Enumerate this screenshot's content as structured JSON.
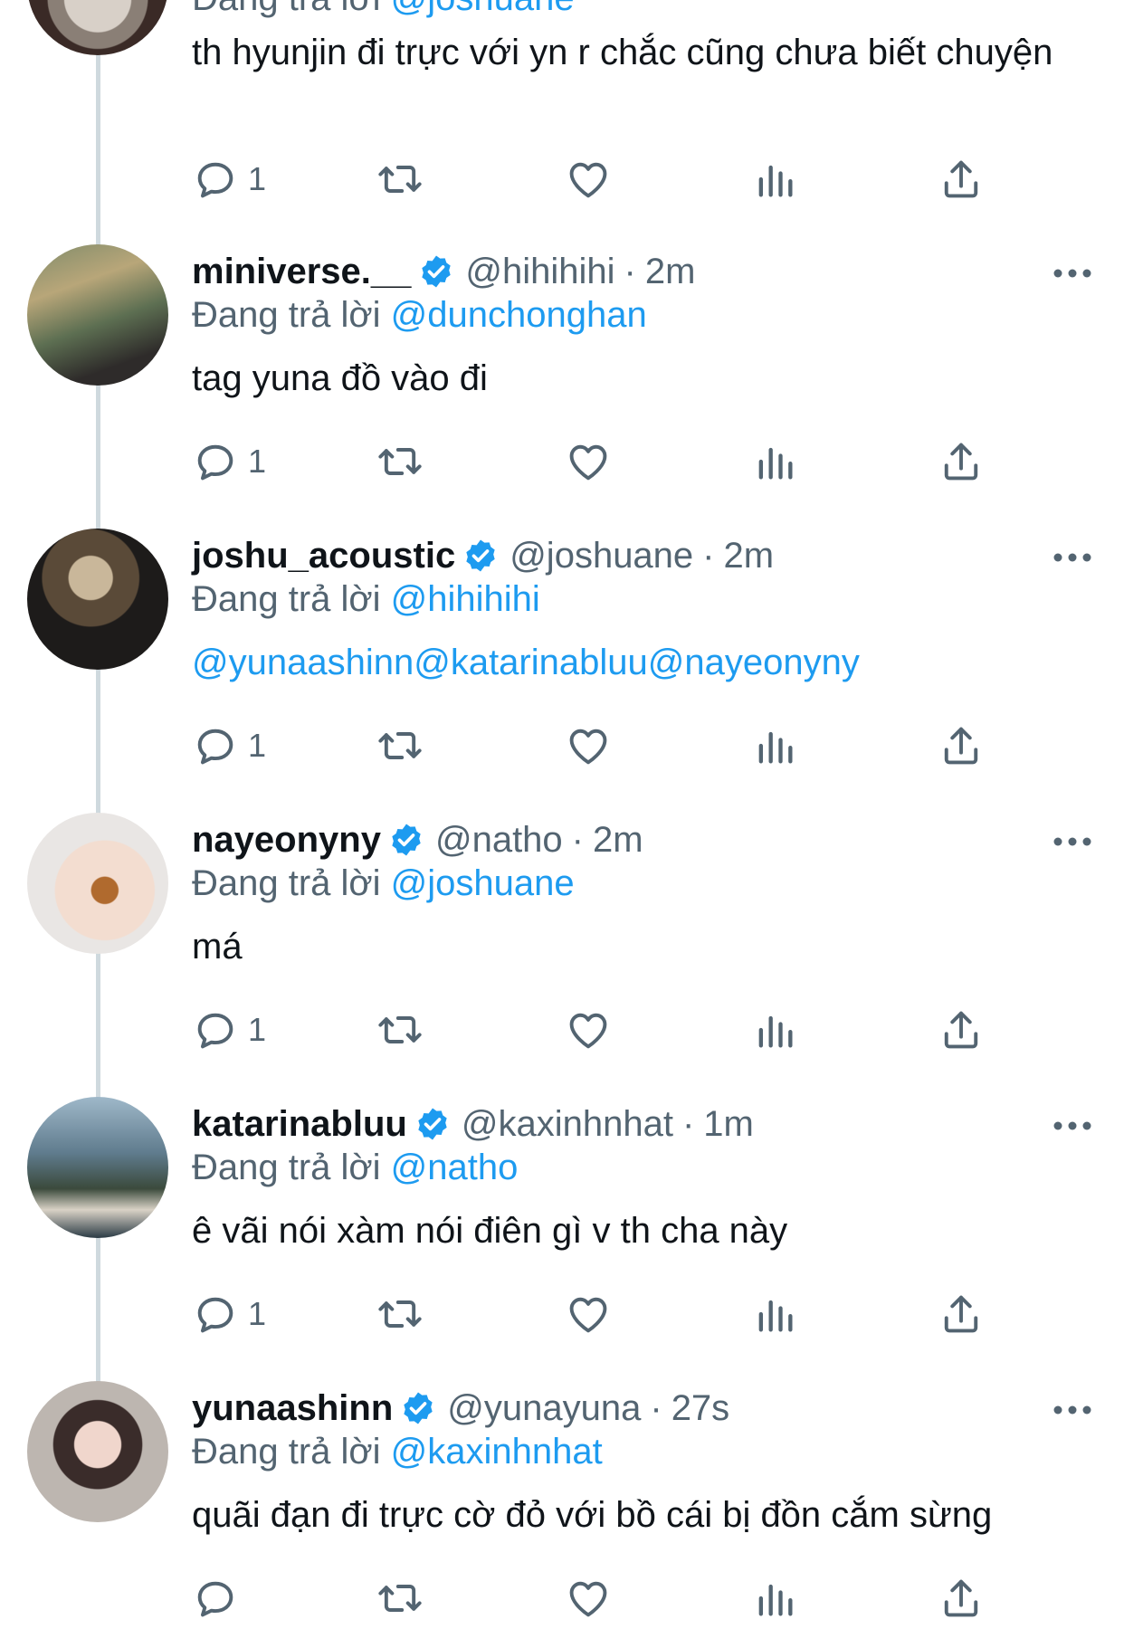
{
  "tweets": [
    {
      "reply_to_prefix": "Đang trả lời",
      "reply_to_handle": "@joshuane",
      "text": "th hyunjin đi trực với yn r chắc cũng chưa biết chuyện",
      "reply_count": "1"
    },
    {
      "name": "miniverse.__",
      "handle": "@hihihihi",
      "sep": "·",
      "time": "2m",
      "reply_to_prefix": "Đang trả lời",
      "reply_to_handle": "@dunchonghan",
      "text": "tag yuna đồ vào đi",
      "reply_count": "1"
    },
    {
      "name": "joshu_acoustic",
      "handle": "@joshuane",
      "sep": "·",
      "time": "2m",
      "reply_to_prefix": "Đang trả lời",
      "reply_to_handle": "@hihihihi",
      "text": "@yunaashinn@katarinabluu@nayeonyny",
      "reply_count": "1"
    },
    {
      "name": "nayeonyny",
      "handle": "@natho",
      "sep": "·",
      "time": "2m",
      "reply_to_prefix": "Đang trả lời",
      "reply_to_handle": "@joshuane",
      "text": "má",
      "reply_count": "1"
    },
    {
      "name": "katarinabluu",
      "handle": "@kaxinhnhat",
      "sep": "·",
      "time": "1m",
      "reply_to_prefix": "Đang trả lời",
      "reply_to_handle": "@natho",
      "text": "ê vãi nói xàm nói điên gì v th cha này",
      "reply_count": "1"
    },
    {
      "name": "yunaashinn",
      "handle": "@yunayuna",
      "sep": "·",
      "time": "27s",
      "reply_to_prefix": "Đang trả lời",
      "reply_to_handle": "@kaxinhnhat",
      "text": "quãi đạn đi trực cờ đỏ với bồ cái bị đồn cắm sừng",
      "reply_count": ""
    }
  ],
  "icons": {
    "reply": "reply-icon",
    "retweet": "retweet-icon",
    "like": "heart-icon",
    "views": "views-icon",
    "share": "share-icon",
    "more": "more-icon",
    "verified": "verified-badge-icon"
  },
  "colors": {
    "link": "#1d9bf0",
    "muted": "#536471",
    "text": "#0f1419",
    "thread_line": "#cfd9de"
  }
}
